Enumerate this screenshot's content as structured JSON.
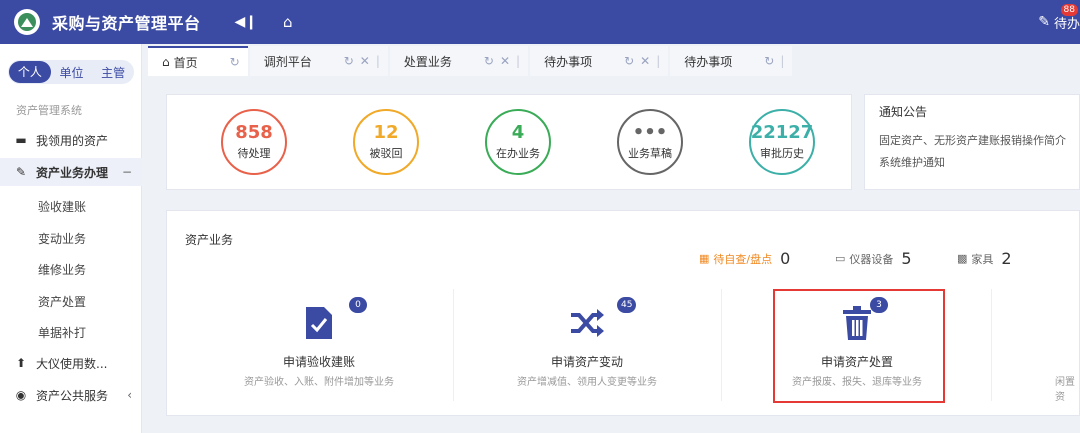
{
  "header": {
    "app_title": "采购与资产管理平台",
    "todo_label": "待办",
    "todo_badge": "88"
  },
  "sidebar": {
    "segments": [
      "个人",
      "单位",
      "主管"
    ],
    "section_title": "资产管理系统",
    "items": [
      {
        "label": "我领用的资产",
        "icon": "laptop-icon"
      },
      {
        "label": "资产业务办理",
        "icon": "pencil-icon",
        "caret": "−"
      },
      {
        "label": "验收建账"
      },
      {
        "label": "变动业务"
      },
      {
        "label": "维修业务"
      },
      {
        "label": "资产处置"
      },
      {
        "label": "单据补打"
      },
      {
        "label": "大仪使用数...",
        "icon": "upload-icon"
      },
      {
        "label": "资产公共服务",
        "icon": "globe-icon",
        "caret": "‹"
      }
    ]
  },
  "tabs": [
    {
      "label": "首页"
    },
    {
      "label": "调剂平台"
    },
    {
      "label": "处置业务"
    },
    {
      "label": "待办事项"
    },
    {
      "label": "待办事项"
    }
  ],
  "stats": [
    {
      "value": "858",
      "label": "待处理",
      "color": "#e8614a"
    },
    {
      "value": "12",
      "label": "被驳回",
      "color": "#f0a928"
    },
    {
      "value": "4",
      "label": "在办业务",
      "color": "#3aab57"
    },
    {
      "value": "•••",
      "label": "业务草稿",
      "color": "#666666"
    },
    {
      "value": "22127",
      "label": "审批历史",
      "color": "#3cb0a8"
    }
  ],
  "notice": {
    "title": "通知公告",
    "items": [
      "固定资产、无形资产建账报销操作简介",
      "系统维护通知"
    ]
  },
  "business": {
    "title": "资产业务",
    "metrics": [
      {
        "label": "待自查/盘点",
        "value": "0",
        "color": "#f08a24"
      },
      {
        "label": "仪器设备",
        "value": "5"
      },
      {
        "label": "家具",
        "value": "2"
      }
    ],
    "cards": [
      {
        "title": "申请验收建账",
        "desc": "资产验收、入账、附件增加等业务",
        "badge": "0"
      },
      {
        "title": "申请资产变动",
        "desc": "资产增减值、领用人变更等业务",
        "badge": "45"
      },
      {
        "title": "申请资产处置",
        "desc": "资产报废、报失、退库等业务",
        "badge": "3"
      },
      {
        "title": "",
        "desc": "闲置资"
      }
    ]
  },
  "colors": {
    "primary": "#3b4aa3",
    "highlight": "#e53935"
  }
}
